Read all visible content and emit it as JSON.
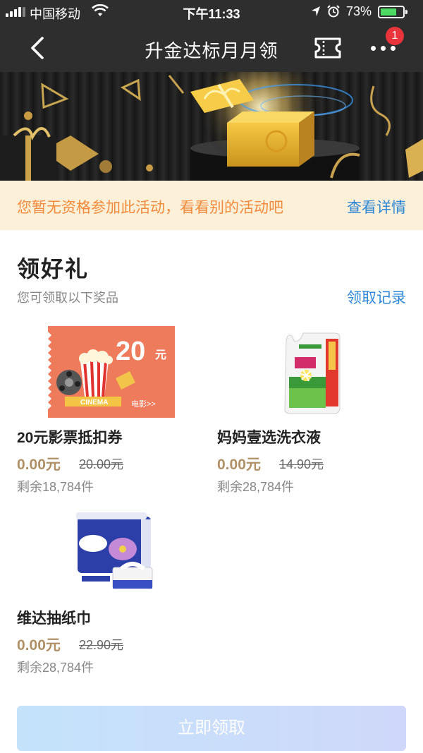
{
  "status_bar": {
    "carrier": "中国移动",
    "time": "下午11:33",
    "battery_percent": "73%",
    "battery_level": 0.73
  },
  "nav": {
    "title": "升金达标月月领",
    "more_badge": "1"
  },
  "notice": {
    "text": "您暂无资格参加此活动，看看别的活动吧",
    "link": "查看详情"
  },
  "section": {
    "title": "领好礼",
    "subtitle": "您可领取以下奖品",
    "record_link": "领取记录"
  },
  "products": [
    {
      "name": "20元影票抵扣券",
      "price": "0.00元",
      "original_price": "20.00元",
      "stock": "剩余18,784件",
      "image_text": {
        "amount": "20",
        "unit": "元",
        "cinema": "CINEMA",
        "movie_link": "电影>>"
      }
    },
    {
      "name": "妈妈壹选洗衣液",
      "price": "0.00元",
      "original_price": "14.90元",
      "stock": "剩余28,784件"
    },
    {
      "name": "维达抽纸巾",
      "price": "0.00元",
      "original_price": "22.90元",
      "stock": "剩余28,784件"
    }
  ],
  "claim_button": "立即领取",
  "colors": {
    "accent_blue": "#2f88d8",
    "notice_orange": "#f08a3c",
    "price_gold": "#b09066",
    "badge_red": "#e8343a",
    "nav_bg": "#2e2e2e"
  },
  "icons": {
    "back": "chevron-left-icon",
    "ticket": "ticket-icon",
    "more": "more-dots-icon",
    "wifi": "wifi-icon",
    "location": "location-arrow-icon",
    "alarm": "alarm-clock-icon"
  }
}
